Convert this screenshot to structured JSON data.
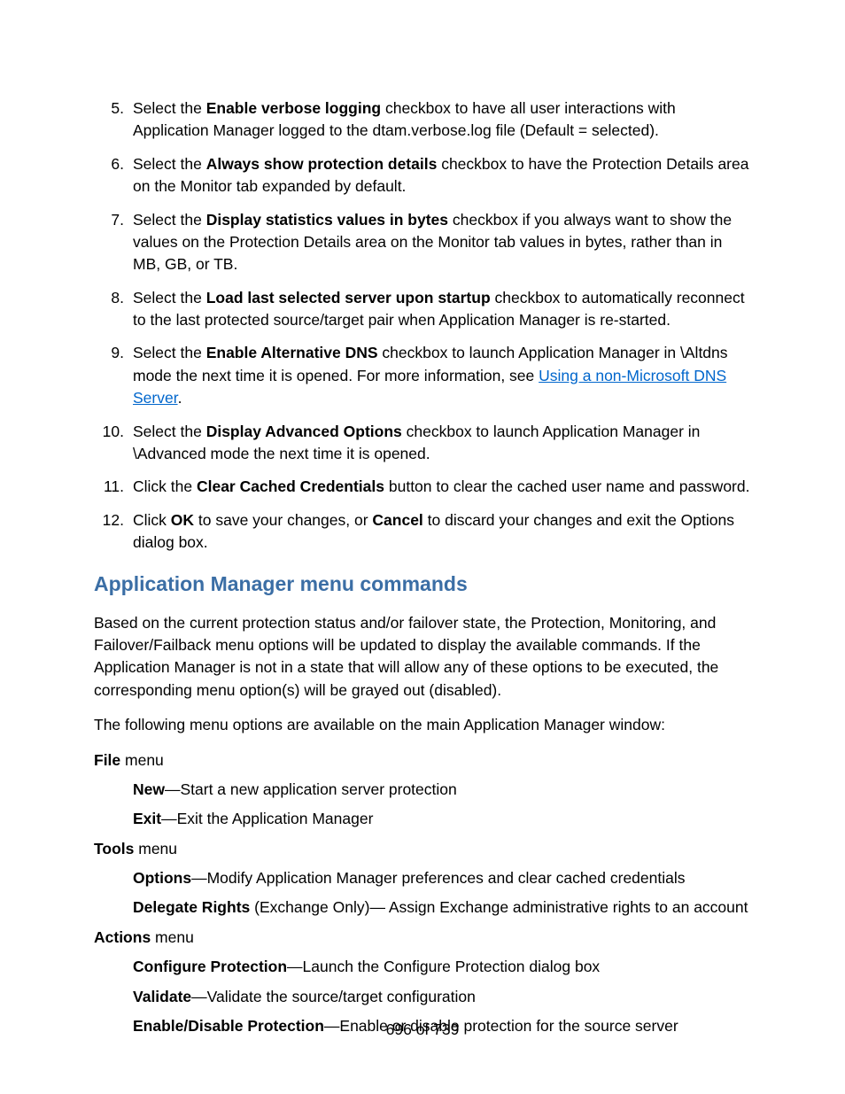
{
  "steps": [
    {
      "n": "5.",
      "pre": "Select the ",
      "bold": "Enable verbose logging",
      "post": " checkbox to have all user interactions with Application Manager logged to the dtam.verbose.log file (Default = selected)."
    },
    {
      "n": "6.",
      "pre": "Select the ",
      "bold": "Always show protection details",
      "post": " checkbox to have the Protection Details area on the Monitor tab expanded by default."
    },
    {
      "n": "7.",
      "pre": "Select the ",
      "bold": "Display statistics values in bytes",
      "post": " checkbox if you always want to show the values on the Protection Details area on the Monitor tab values in bytes, rather than in MB, GB, or TB."
    },
    {
      "n": "8.",
      "pre": "Select the ",
      "bold": "Load last selected server upon startup",
      "post": " checkbox to automatically reconnect to the last protected source/target pair when Application Manager is re-started."
    }
  ],
  "step9": {
    "n": "9.",
    "pre": "Select the ",
    "bold": "Enable Alternative DNS",
    "mid": " checkbox to launch Application Manager in \\Altdns mode the next time it is opened. For more information, see ",
    "link": "Using a non-Microsoft DNS Server",
    "post": "."
  },
  "step10": {
    "n": "10.",
    "pre": "Select the ",
    "bold": "Display Advanced Options",
    "post": " checkbox to launch Application Manager in \\Advanced mode the next time it is opened."
  },
  "step11": {
    "n": "11.",
    "pre": "Click the ",
    "bold": "Clear Cached Credentials",
    "post": " button to clear the cached user name and password."
  },
  "step12": {
    "n": "12.",
    "pre": "Click ",
    "bold1": "OK",
    "mid": " to save your changes, or ",
    "bold2": "Cancel",
    "post": " to discard your changes and exit the Options dialog box."
  },
  "heading": "Application Manager menu commands",
  "intro1": "Based on the current protection status and/or failover state, the Protection, Monitoring, and Failover/Failback menu options will be updated to display the available commands. If the Application Manager is not in a state that will allow any of these options to be executed, the corresponding menu option(s) will be grayed out (disabled).",
  "intro2": "The following menu options are available on the main Application Manager window:",
  "file": {
    "head_bold": "File",
    "head_rest": " menu",
    "items": [
      {
        "b": "New",
        "rest": "—Start a new application server protection"
      },
      {
        "b": "Exit",
        "rest": "—Exit the Application Manager"
      }
    ]
  },
  "tools": {
    "head_bold": "Tools",
    "head_rest": " menu",
    "items": [
      {
        "b": "Options",
        "rest": "—Modify Application Manager preferences and clear cached credentials"
      },
      {
        "b": "Delegate Rights",
        "rest": " (Exchange Only)— Assign Exchange administrative rights to an account"
      }
    ]
  },
  "actions": {
    "head_bold": "Actions",
    "head_rest": " menu",
    "items": [
      {
        "b": "Configure Protection",
        "rest": "—Launch the Configure Protection dialog box"
      },
      {
        "b": "Validate",
        "rest": "—Validate the source/target configuration"
      },
      {
        "b": "Enable/Disable Protection",
        "rest": "—Enable or disable protection for the source server"
      }
    ]
  },
  "footer": "696 of 739"
}
